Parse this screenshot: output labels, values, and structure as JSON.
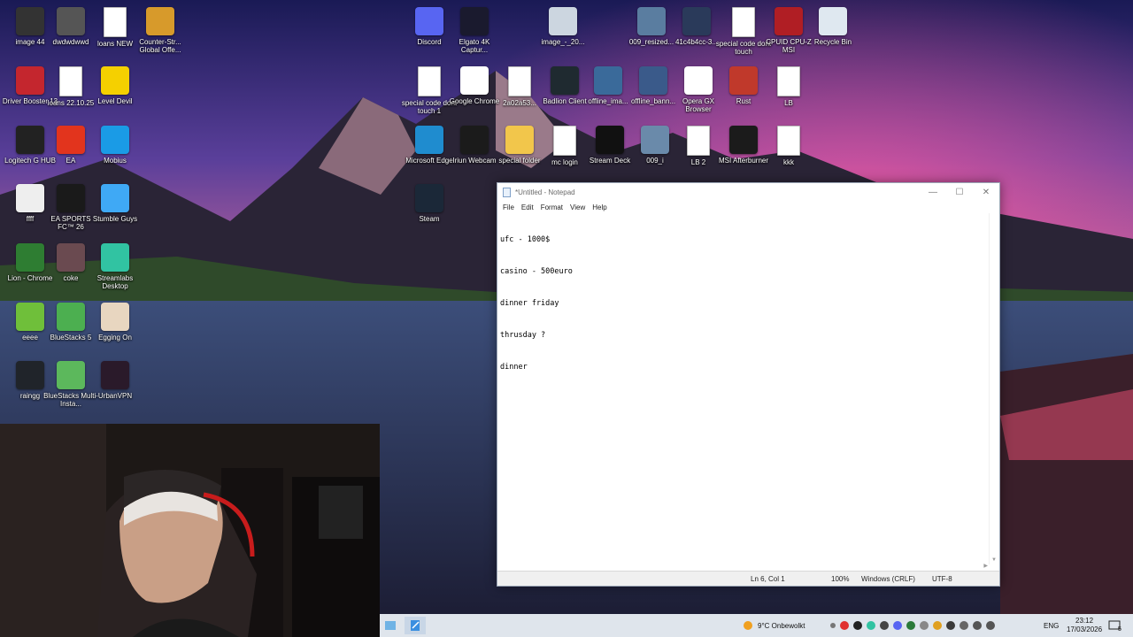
{
  "colors": {
    "notepad_bg": "#ffffff",
    "taskbar_bg": "#dfe5ec",
    "wallpaper_sky": "#3a2a6a"
  },
  "desktop_icons": [
    {
      "label": "image 44",
      "icon": "image-icon",
      "color": "#333333"
    },
    {
      "label": "dwdwdwwd",
      "icon": "file-icon",
      "color": "#555555"
    },
    {
      "label": "loans NEW",
      "icon": "text-file-icon",
      "color": "#ffffff"
    },
    {
      "label": "Counter-Str... Global Offe...",
      "icon": "csgo-icon",
      "color": "#d79a2b"
    },
    {
      "label": "Driver Booster 13",
      "icon": "driver-booster-icon",
      "color": "#c4262e"
    },
    {
      "label": "loans 22.10.25",
      "icon": "text-file-icon",
      "color": "#ffffff"
    },
    {
      "label": "Level Devil",
      "icon": "level-devil-icon",
      "color": "#f5d000"
    },
    {
      "label": "Logitech G HUB",
      "icon": "logitech-icon",
      "color": "#222222"
    },
    {
      "label": "EA",
      "icon": "ea-icon",
      "color": "#e2341d"
    },
    {
      "label": "Mobius",
      "icon": "mobius-icon",
      "color": "#1a9be6"
    },
    {
      "label": "ffff",
      "icon": "image-icon",
      "color": "#eeeeee"
    },
    {
      "label": "EA SPORTS FC™ 26",
      "icon": "fc26-icon",
      "color": "#1a1a1a"
    },
    {
      "label": "Stumble Guys",
      "icon": "stumble-guys-icon",
      "color": "#3fa9f5"
    },
    {
      "label": "Lion - Chrome",
      "icon": "chrome-icon",
      "color": "#2e7d32"
    },
    {
      "label": "coke",
      "icon": "image-icon",
      "color": "#6a4a50"
    },
    {
      "label": "Streamlabs Desktop",
      "icon": "streamlabs-icon",
      "color": "#31c3a2"
    },
    {
      "label": "eeee",
      "icon": "image-icon",
      "color": "#6fbf3a"
    },
    {
      "label": "BlueStacks 5",
      "icon": "bluestacks-icon",
      "color": "#4caf50"
    },
    {
      "label": "Egging On",
      "icon": "egg-icon",
      "color": "#e8d6c0"
    },
    {
      "label": "raingg",
      "icon": "image-icon",
      "color": "#20242a"
    },
    {
      "label": "BlueStacks Multi-Insta...",
      "icon": "bluestacks-icon",
      "color": "#5cb85c"
    },
    {
      "label": "UrbanVPN",
      "icon": "urbanvpn-icon",
      "color": "#2a1a2a"
    },
    {
      "label": "Discord",
      "icon": "discord-icon",
      "color": "#5865f2"
    },
    {
      "label": "Elgato 4K Captur...",
      "icon": "elgato-icon",
      "color": "#1a1a2e"
    },
    {
      "label": "image_-_20...",
      "icon": "image-icon",
      "color": "#ccd6e0"
    },
    {
      "label": "009_resized...",
      "icon": "image-icon",
      "color": "#5a7da0"
    },
    {
      "label": "41c4b4cc-3...",
      "icon": "image-icon",
      "color": "#2a3a5a"
    },
    {
      "label": "special code dont touch",
      "icon": "text-file-icon",
      "color": "#ffffff"
    },
    {
      "label": "CPUID CPU-Z MSI",
      "icon": "cpuz-icon",
      "color": "#b01e24"
    },
    {
      "label": "Recycle Bin",
      "icon": "recycle-bin-icon",
      "color": "#dfe8f0"
    },
    {
      "label": "special code dont touch 1",
      "icon": "text-file-icon",
      "color": "#ffffff"
    },
    {
      "label": "Google Chrome",
      "icon": "chrome-icon",
      "color": "#ffffff"
    },
    {
      "label": "2a02a53...",
      "icon": "text-file-icon",
      "color": "#ffffff"
    },
    {
      "label": "Badlion Client",
      "icon": "badlion-icon",
      "color": "#1f2a30"
    },
    {
      "label": "offline_ima...",
      "icon": "image-icon",
      "color": "#3a6a9a"
    },
    {
      "label": "offline_bann...",
      "icon": "image-icon",
      "color": "#3a5a8a"
    },
    {
      "label": "Opera GX Browser",
      "icon": "opera-gx-icon",
      "color": "#ffffff"
    },
    {
      "label": "Rust",
      "icon": "rust-icon",
      "color": "#c0392b"
    },
    {
      "label": "LB",
      "icon": "text-file-icon",
      "color": "#ffffff"
    },
    {
      "label": "Microsoft Edge",
      "icon": "edge-icon",
      "color": "#1f8ccf"
    },
    {
      "label": "Iriun Webcam",
      "icon": "webcam-icon",
      "color": "#1b1b1b"
    },
    {
      "label": "special folder",
      "icon": "folder-icon",
      "color": "#f2c64b"
    },
    {
      "label": "mc login",
      "icon": "text-file-icon",
      "color": "#ffffff"
    },
    {
      "label": "Stream Deck",
      "icon": "stream-deck-icon",
      "color": "#111111"
    },
    {
      "label": "009_i",
      "icon": "image-icon",
      "color": "#6a8aaa"
    },
    {
      "label": "LB 2",
      "icon": "text-file-icon",
      "color": "#ffffff"
    },
    {
      "label": "MSI Afterburner",
      "icon": "msi-afterburner-icon",
      "color": "#1b1b1b"
    },
    {
      "label": "kkk",
      "icon": "text-file-icon",
      "color": "#ffffff"
    },
    {
      "label": "Steam",
      "icon": "steam-icon",
      "color": "#1b2838"
    }
  ],
  "notepad": {
    "title": "*Untitled - Notepad",
    "menu": [
      "File",
      "Edit",
      "Format",
      "View",
      "Help"
    ],
    "lines": [
      "ufc - 1000$",
      "casino - 500euro",
      "dinner friday",
      "thrusday ?",
      "dinner"
    ],
    "status": {
      "position": "Ln 6, Col 1",
      "zoom": "100%",
      "line_ending": "Windows (CRLF)",
      "encoding": "UTF-8"
    }
  },
  "taskbar": {
    "weather": "9°C  Onbewolkt",
    "language": "ENG",
    "time": "23:12",
    "date": "17/03/2026",
    "notifications": "5"
  }
}
